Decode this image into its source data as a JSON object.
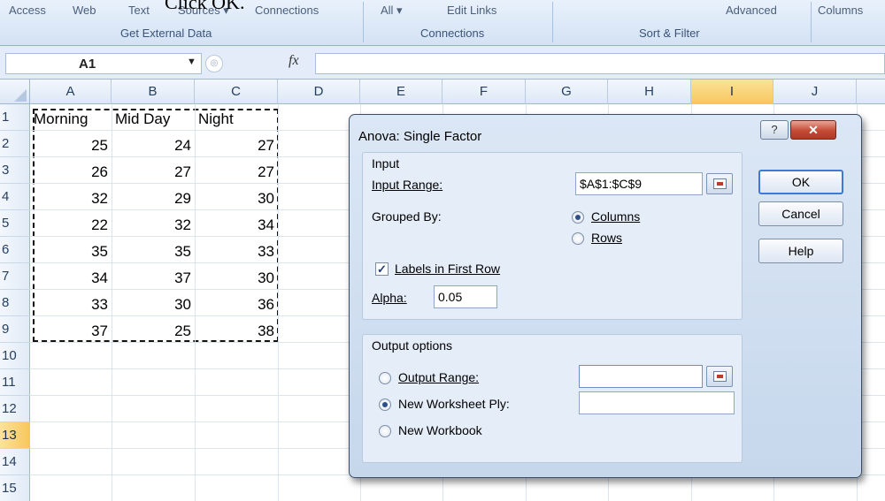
{
  "top_caption": "Click OK.",
  "ribbon": {
    "buttons": [
      "Access",
      "Web",
      "Text",
      "Sources ▾",
      "Connections",
      "All ▾",
      "Edit Links",
      "Advanced",
      "Columns"
    ],
    "groups": [
      "Get External Data",
      "Connections",
      "Sort & Filter"
    ]
  },
  "formula_bar": {
    "name_box": "A1",
    "fx_label": "fx",
    "value": ""
  },
  "sheet": {
    "columns": [
      "A",
      "B",
      "C",
      "D",
      "E",
      "F",
      "G",
      "H",
      "I",
      "J"
    ],
    "selected_column": "I",
    "rows": [
      "1",
      "2",
      "3",
      "4",
      "5",
      "6",
      "7",
      "8",
      "9",
      "10",
      "11",
      "12",
      "13",
      "14",
      "15"
    ],
    "selected_row": "13",
    "headers": [
      "Morning",
      "Mid Day",
      "Night"
    ],
    "values": [
      [
        25,
        24,
        27
      ],
      [
        26,
        27,
        27
      ],
      [
        32,
        29,
        30
      ],
      [
        22,
        32,
        34
      ],
      [
        35,
        35,
        33
      ],
      [
        34,
        37,
        30
      ],
      [
        33,
        30,
        36
      ],
      [
        37,
        25,
        38
      ]
    ]
  },
  "dialog": {
    "title": "Anova: Single Factor",
    "help_glyph": "?",
    "close_glyph": "✕",
    "input": {
      "section_label": "Input",
      "input_range_label": "Input Range:",
      "input_range_value": "$A$1:$C$9",
      "grouped_by_label": "Grouped By:",
      "columns_label": "Columns",
      "rows_label": "Rows",
      "grouped_by_selected": "Columns",
      "labels_first_row_label": "Labels in First Row",
      "labels_first_row_checked": true,
      "alpha_label": "Alpha:",
      "alpha_value": "0.05"
    },
    "output": {
      "section_label": "Output options",
      "output_range_label": "Output Range:",
      "output_range_value": "",
      "new_worksheet_label": "New Worksheet Ply:",
      "new_worksheet_value": "",
      "new_workbook_label": "New Workbook",
      "selected": "New Worksheet Ply"
    },
    "buttons": {
      "ok": "OK",
      "cancel": "Cancel",
      "help": "Help"
    }
  }
}
